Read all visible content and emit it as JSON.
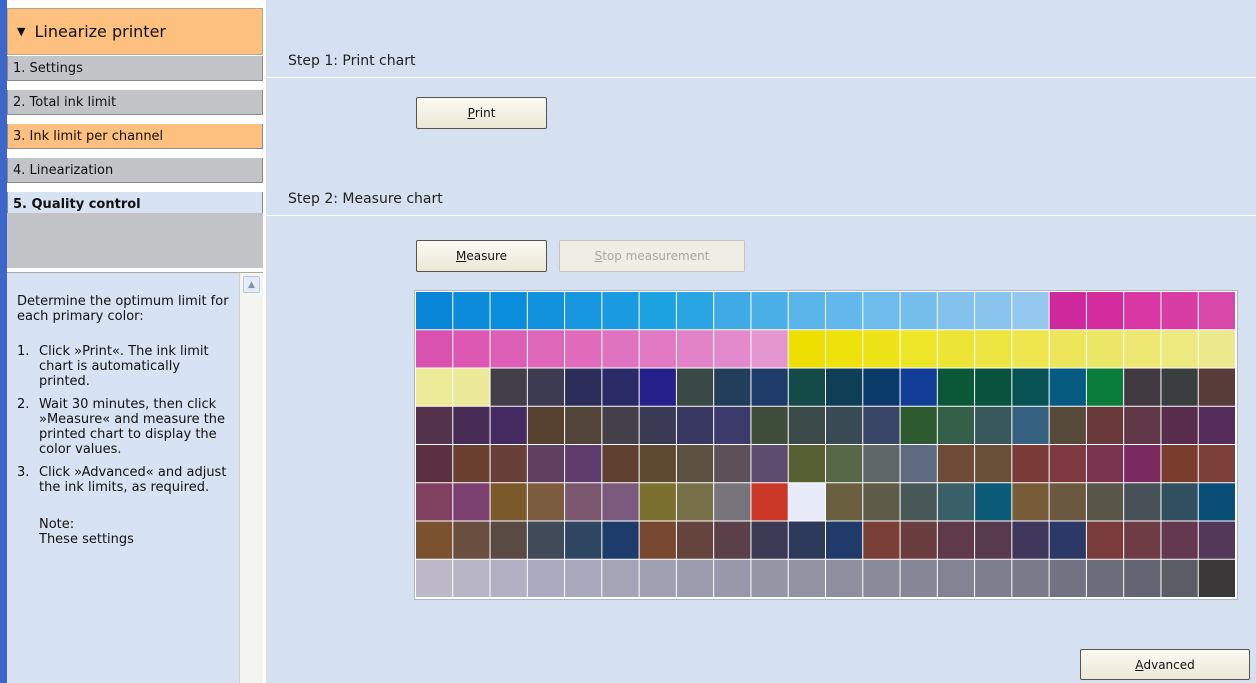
{
  "sidebar": {
    "section_title": "Linearize printer",
    "items": [
      {
        "label": "1. Settings",
        "state": "normal"
      },
      {
        "label": "2. Total ink limit",
        "state": "normal"
      },
      {
        "label": "3. Ink limit per channel",
        "state": "active"
      },
      {
        "label": "4. Linearization",
        "state": "normal"
      },
      {
        "label": "5. Quality control",
        "state": "current"
      }
    ]
  },
  "help": {
    "intro": "Determine the optimum limit for each primary color:",
    "steps": [
      {
        "num": "1.",
        "text": "Click »Print«. The ink limit chart is automatically printed."
      },
      {
        "num": "2.",
        "text": "Wait 30 minutes, then click »Measure« and measure the printed chart to display the color values."
      },
      {
        "num": "3.",
        "text": "Click »Advanced« and adjust the ink limits, as required."
      }
    ],
    "note_label": "Note:",
    "note_text": "These settings"
  },
  "main": {
    "step1_title": "Step 1: Print chart",
    "print_button": {
      "mnemonic": "P",
      "rest": "rint"
    },
    "step2_title": "Step 2: Measure chart",
    "measure_button": {
      "mnemonic": "M",
      "rest": "easure"
    },
    "stop_button": {
      "mnemonic": "S",
      "rest": "top measurement"
    },
    "advanced_button": {
      "mnemonic": "A",
      "rest": "dvanced"
    }
  },
  "colors": {
    "left_edge": "#3c66cc",
    "panel_bg": "#d5e0f1",
    "active_step": "#fdc07e",
    "inactive_step": "#c2c4c8"
  },
  "chart": {
    "rows": [
      [
        "#0a86d8",
        "#0c8bdb",
        "#0a8ddd",
        "#1092dd",
        "#1697df",
        "#1a9ae0",
        "#1ea3e2",
        "#2aa5e3",
        "#40aae6",
        "#4bb0e8",
        "#5ab5ea",
        "#62b7eb",
        "#6ebcec",
        "#76bfed",
        "#84c2ee",
        "#88c4ee",
        "#94c8ef",
        "#cf289c",
        "#d42c9e",
        "#d836a2",
        "#d83da4",
        "#d848a8"
      ],
      [
        "#d952b0",
        "#dc58b2",
        "#de60b6",
        "#df67b9",
        "#e06cbb",
        "#e073bf",
        "#e17ac3",
        "#e283c7",
        "#e28acb",
        "#e397ce",
        "#eedf00",
        "#eee20c",
        "#ede317",
        "#ece528",
        "#ede536",
        "#ede641",
        "#ede74d",
        "#ede65a",
        "#ede768",
        "#ede872",
        "#ece97e",
        "#ece98c"
      ],
      [
        "#eeeb98",
        "#ecea98",
        "#433e48",
        "#3c3b52",
        "#2c2c5a",
        "#2a2a66",
        "#25208a",
        "#3a4846",
        "#233e5a",
        "#1e3b6a",
        "#144a48",
        "#0e3f56",
        "#0a3a6a",
        "#123e98",
        "#0a5838",
        "#08523e",
        "#065254",
        "#065c80",
        "#0a7c3a",
        "#403a40",
        "#3a3e3e",
        "#583c3a"
      ],
      [
        "#54344c",
        "#472d55",
        "#452a62",
        "#564030",
        "#524438",
        "#44404a",
        "#3a3a55",
        "#393862",
        "#3d3a6c",
        "#3e4c3a",
        "#3a4a48",
        "#3a4a54",
        "#384566",
        "#2e5a30",
        "#34604a",
        "#36585a",
        "#356080",
        "#584a3a",
        "#6a3a3a",
        "#603848",
        "#582c4c",
        "#562c5a"
      ],
      [
        "#5c3040",
        "#6a4030",
        "#684038",
        "#604060",
        "#603c6c",
        "#604030",
        "#5e4a30",
        "#5c5040",
        "#5e5058",
        "#5e4c6e",
        "#566030",
        "#566848",
        "#5e6868",
        "#5e6a80",
        "#6e4c38",
        "#6a5038",
        "#7a3a38",
        "#7e3a40",
        "#7a3450",
        "#7a2a60",
        "#7a3c2c",
        "#7c4038"
      ],
      [
        "#804060",
        "#7c4070",
        "#7a5a2a",
        "#7c5c40",
        "#7c5870",
        "#7c5a7e",
        "#7c7030",
        "#787048",
        "#78747c",
        "#cc3828",
        "#e8ecfa",
        "#6a6040",
        "#5e5c48",
        "#485858",
        "#3a6068",
        "#0a5a78",
        "#785c38",
        "#6a5840",
        "#5a5648",
        "#485058",
        "#305060",
        "#084e76"
      ],
      [
        "#7a5230",
        "#6a4e40",
        "#5a4a44",
        "#404a58",
        "#2e4662",
        "#1e3c6a",
        "#784830",
        "#64443c",
        "#5a4048",
        "#3c3a54",
        "#2e3a5c",
        "#203a6a",
        "#7a4038",
        "#6a3e3e",
        "#5e3a4a",
        "#583a4e",
        "#40385c",
        "#2c3866",
        "#7a3c3a",
        "#6e3c44",
        "#64384e",
        "#54385a"
      ],
      [
        "#bcb8c8",
        "#b8b6c6",
        "#b2b0c2",
        "#acaac0",
        "#a8a8bc",
        "#a4a4b6",
        "#a0a0b2",
        "#9c9cae",
        "#9898aa",
        "#9696a6",
        "#9292a2",
        "#8e8e9e",
        "#8a8a9a",
        "#868696",
        "#828292",
        "#7e7e8e",
        "#7a7a88",
        "#727282",
        "#6c6c7a",
        "#646472",
        "#5c5c66",
        "#3a3838"
      ]
    ]
  }
}
